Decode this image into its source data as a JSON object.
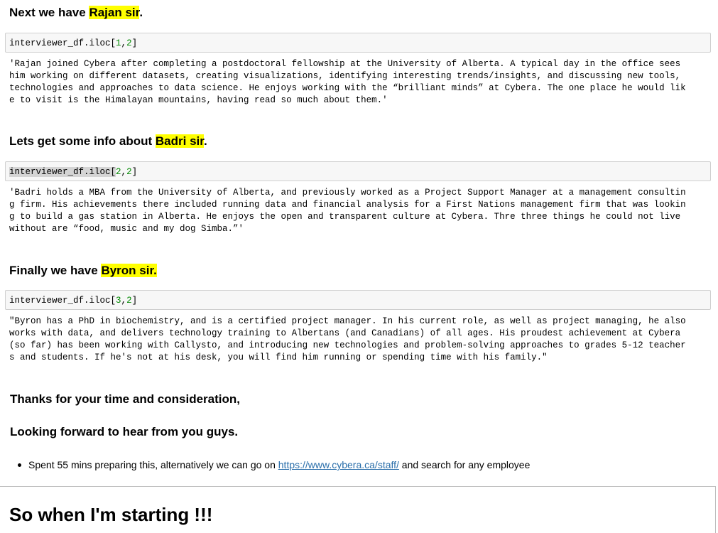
{
  "sections": [
    {
      "heading_prefix": "Next we have ",
      "heading_name": "Rajan sir",
      "heading_suffix": ".",
      "code_prefix": "interviewer_df.iloc[",
      "code_arg1": "1",
      "code_sep": ",",
      "code_arg2": "2",
      "code_suffix": "]",
      "output": "'Rajan joined Cybera after completing a postdoctoral fellowship at the University of Alberta. A typical day in the office sees\nhim working on different datasets, creating visualizations, identifying interesting trends/insights, and discussing new tools,\ntechnologies and approaches to data science. He enjoys working with the “brilliant minds” at Cybera. The one place he would lik\ne to visit is the Himalayan mountains, having read so much about them.'"
    },
    {
      "heading_prefix": "Lets get some info about ",
      "heading_name": "Badri sir",
      "heading_suffix": ".",
      "code_prefix": "interviewer_df.iloc[",
      "code_arg1": "2",
      "code_sep": ",",
      "code_arg2": "2",
      "code_suffix": "]",
      "output": "'Badri holds a MBA from the University of Alberta, and previously worked as a Project Support Manager at a management consultin\ng firm. His achievements there included running data and financial analysis for a First Nations management firm that was lookin\ng to build a gas station in Alberta. He enjoys the open and transparent culture at Cybera. Thre three things he could not live\nwithout are “food, music and my dog Simba.”'"
    },
    {
      "heading_prefix": "Finally we have ",
      "heading_name": "Byron sir.",
      "heading_suffix": "",
      "code_prefix": "interviewer_df.iloc[",
      "code_arg1": "3",
      "code_sep": ",",
      "code_arg2": "2",
      "code_suffix": "]",
      "output": "\"Byron has a PhD in biochemistry, and is a certified project manager. In his current role, as well as project managing, he also\nworks with data, and delivers technology training to Albertans (and Canadians) of all ages. His proudest achievement at Cybera\n(so far) has been working with Callysto, and introducing new technologies and problem-solving approaches to grades 5-12 teacher\ns and students. If he's not at his desk, you will find him running or spending time with his family.\""
    }
  ],
  "closing": {
    "thanks": "Thanks for your time and consideration,",
    "looking_forward": "Looking forward to hear from you guys.",
    "bullet_before": "Spent 55 mins preparing this, alternatively we can go on ",
    "bullet_link": "https://www.cybera.ca/staff/",
    "bullet_after": " and search for any employee"
  },
  "next_cell": {
    "heading": "So when I'm starting !!!"
  },
  "colors": {
    "highlight": "#ffff00",
    "link": "#296eaa",
    "number": "#008800",
    "code_bg": "#f7f7f7"
  }
}
